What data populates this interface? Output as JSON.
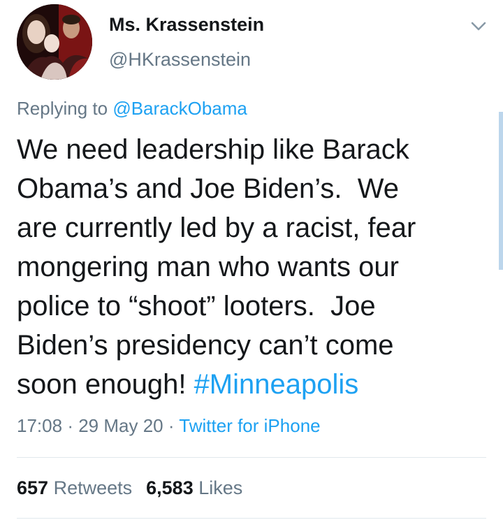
{
  "user": {
    "display_name": "Ms. Krassenstein",
    "handle": "@HKrassenstein"
  },
  "reply": {
    "prefix": "Replying to",
    "mention": "@BarackObama"
  },
  "tweet": {
    "lines": [
      "We need leadership like Barack",
      "Obama’s and Joe Biden’s.  We",
      "are currently led by a racist, fear",
      "mongering man who wants our",
      "police to “shoot” looters.  Joe",
      "Biden’s presidency can’t come",
      "soon enough! "
    ],
    "hashtag": "#Minneapolis"
  },
  "meta": {
    "time": "17:08",
    "date": "29 May 20",
    "separator": "·",
    "source": "Twitter for iPhone"
  },
  "stats": {
    "retweets_count": "657",
    "retweets_label": "Retweets",
    "likes_count": "6,583",
    "likes_label": "Likes"
  },
  "icons": {
    "menu": "chevron-down-icon"
  },
  "colors": {
    "link": "#1da1f2",
    "secondary_text": "#657786",
    "primary_text": "#14171a",
    "divider": "#e1e8ed"
  }
}
